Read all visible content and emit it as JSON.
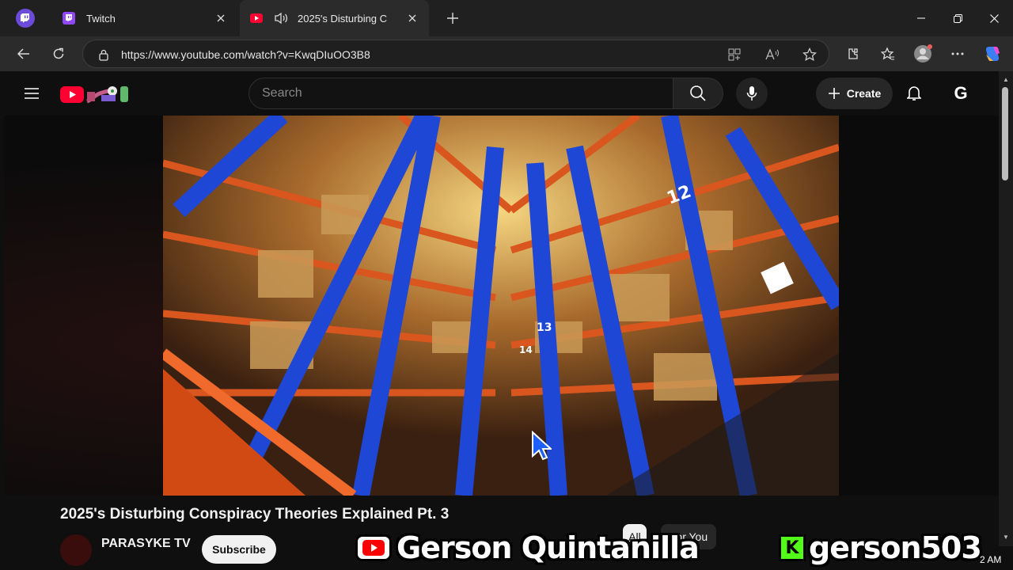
{
  "browser": {
    "tabs": [
      {
        "title": "Twitch",
        "active": false
      },
      {
        "title": "2025's Disturbing C",
        "active": true
      }
    ],
    "url": "https://www.youtube.com/watch?v=KwqDIuOO3B8"
  },
  "youtube": {
    "search_placeholder": "Search",
    "create_label": "Create",
    "account_initial": "G",
    "video_title": "2025's Disturbing Conspiracy Theories Explained Pt. 3",
    "channel_name": "PARASYKE TV",
    "subscribe_label": "Subscribe",
    "chips": [
      "All",
      "For You"
    ]
  },
  "overlays": {
    "streamer_name": "Gerson Quintanilla",
    "handle": "gerson503"
  },
  "clock_fragment": "2 AM",
  "colors": {
    "youtube_red": "#ff0033",
    "kick_green": "#53fc18",
    "twitch_purple": "#9146ff"
  }
}
